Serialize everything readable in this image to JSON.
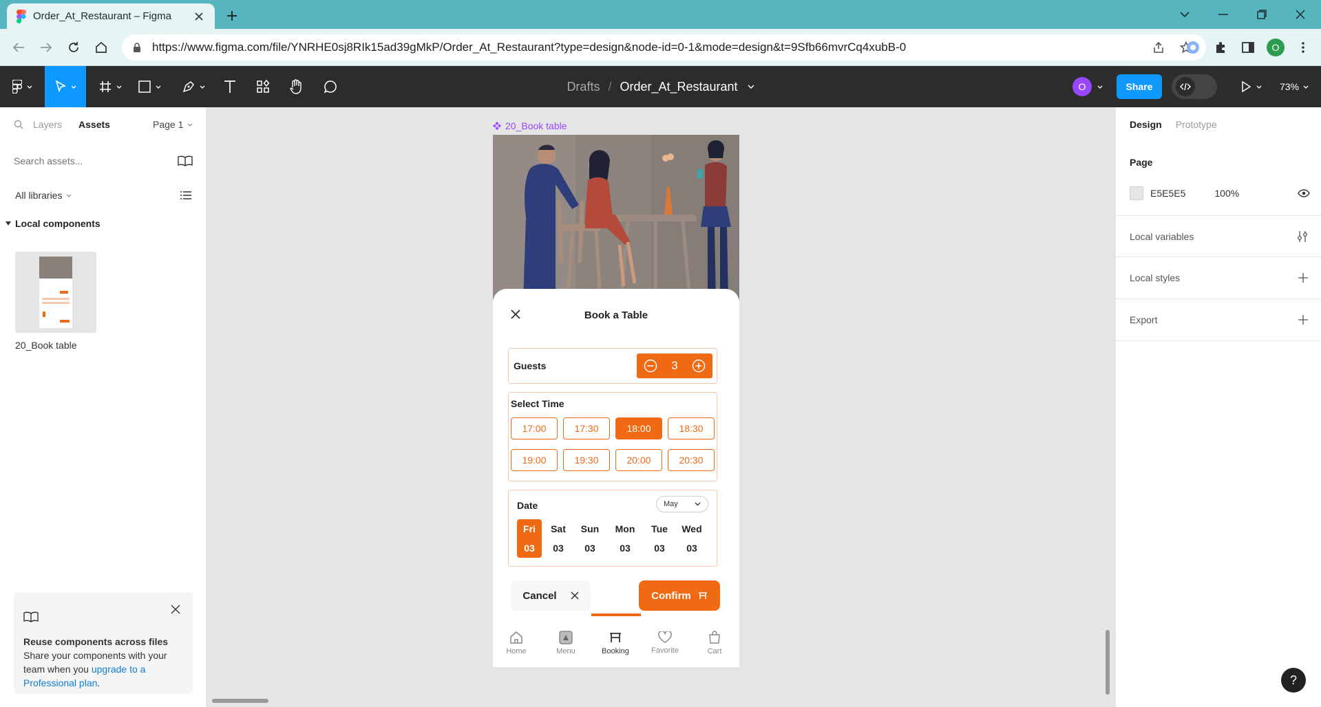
{
  "browser": {
    "tab_title": "Order_At_Restaurant – Figma",
    "url": "https://www.figma.com/file/YNRHE0sj8RIk15ad39gMkP/Order_At_Restaurant?type=design&node-id=0-1&mode=design&t=9Sfb66mvrCq4xubB-0",
    "profile_initial": "O"
  },
  "toolbar": {
    "breadcrumb_parent": "Drafts",
    "breadcrumb_sep": "/",
    "file_name": "Order_At_Restaurant",
    "avatar_initial": "O",
    "share_label": "Share",
    "zoom": "73%"
  },
  "left_panel": {
    "tab_layers": "Layers",
    "tab_assets": "Assets",
    "page_selector": "Page 1",
    "search_placeholder": "Search assets...",
    "libraries_label": "All libraries",
    "section_title": "Local components",
    "component_name": "20_Book table",
    "promo": {
      "title": "Reuse components across files",
      "body": "Share your components with your team when you",
      "link": "upgrade to a Professional plan",
      "end": "."
    }
  },
  "right_panel": {
    "tab_design": "Design",
    "tab_prototype": "Prototype",
    "page_heading": "Page",
    "page_color": "E5E5E5",
    "page_opacity": "100%",
    "local_variables": "Local variables",
    "local_styles": "Local styles",
    "export": "Export"
  },
  "canvas": {
    "frame_label": "20_Book table",
    "sheet_title": "Book a Table",
    "guests_label": "Guests",
    "guests_count": "3",
    "select_time_label": "Select Time",
    "times": [
      "17:00",
      "17:30",
      "18:00",
      "18:30",
      "19:00",
      "19:30",
      "20:00",
      "20:30"
    ],
    "selected_time": "18:00",
    "date_label": "Date",
    "month": "May",
    "days": [
      {
        "name": "Fri",
        "num": "03"
      },
      {
        "name": "Sat",
        "num": "03"
      },
      {
        "name": "Sun",
        "num": "03"
      },
      {
        "name": "Mon",
        "num": "03"
      },
      {
        "name": "Tue",
        "num": "03"
      },
      {
        "name": "Wed",
        "num": "03"
      }
    ],
    "cancel_label": "Cancel",
    "confirm_label": "Confirm",
    "nav": [
      "Home",
      "Menu",
      "Booking",
      "Favorite",
      "Cart"
    ],
    "active_nav": "Booking"
  },
  "colors": {
    "accent": "#F06A14",
    "figma_blue": "#0D99FF",
    "frame_purple": "#9747FF",
    "tab_teal": "#57B5BF"
  },
  "help_label": "?"
}
